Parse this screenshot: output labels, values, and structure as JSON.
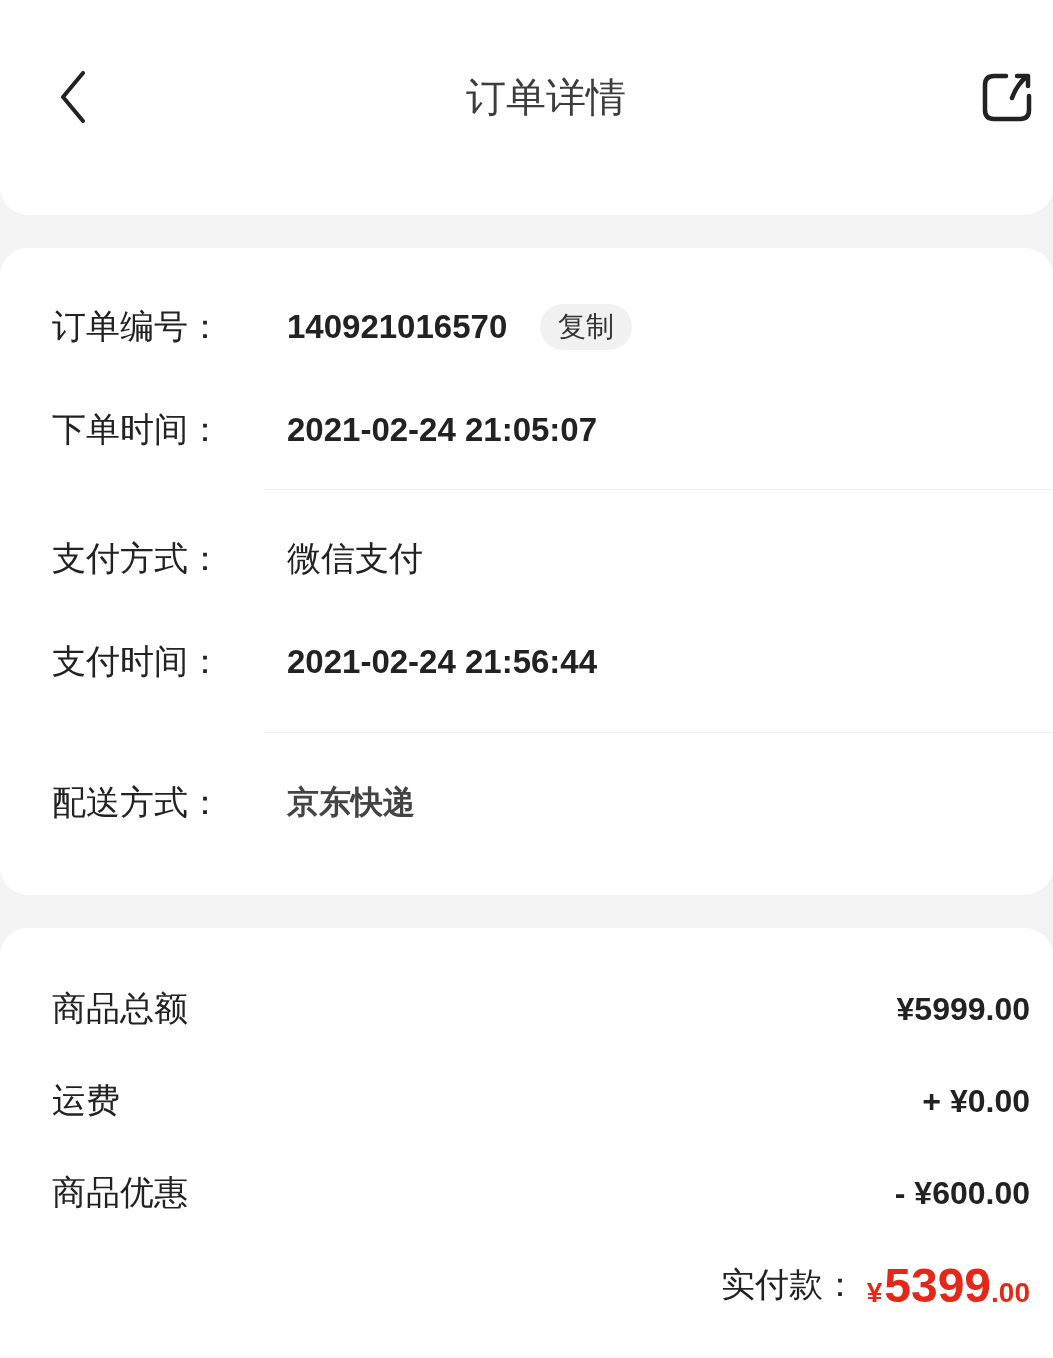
{
  "header": {
    "title": "订单详情"
  },
  "order_info": {
    "sections": [
      {
        "rows": [
          {
            "kind": "number",
            "label": "订单编号：",
            "value": "140921016570",
            "action": "复制"
          },
          {
            "kind": "number",
            "label": "下单时间：",
            "value": "2021-02-24 21:05:07"
          }
        ]
      },
      {
        "rows": [
          {
            "kind": "text",
            "label": "支付方式：",
            "value": "微信支付"
          },
          {
            "kind": "number",
            "label": "支付时间：",
            "value": "2021-02-24 21:56:44"
          }
        ]
      },
      {
        "rows": [
          {
            "kind": "brand",
            "label": "配送方式：",
            "value": "京东快递"
          }
        ]
      }
    ]
  },
  "price_summary": {
    "rows": [
      {
        "label": "商品总额",
        "value": "¥5999.00"
      },
      {
        "label": "运费",
        "value": "+ ¥0.00"
      },
      {
        "label": "商品优惠",
        "value": "- ¥600.00"
      }
    ],
    "total": {
      "label": "实付款：",
      "currency": "¥",
      "integer": "5399",
      "fraction": ".00"
    }
  }
}
